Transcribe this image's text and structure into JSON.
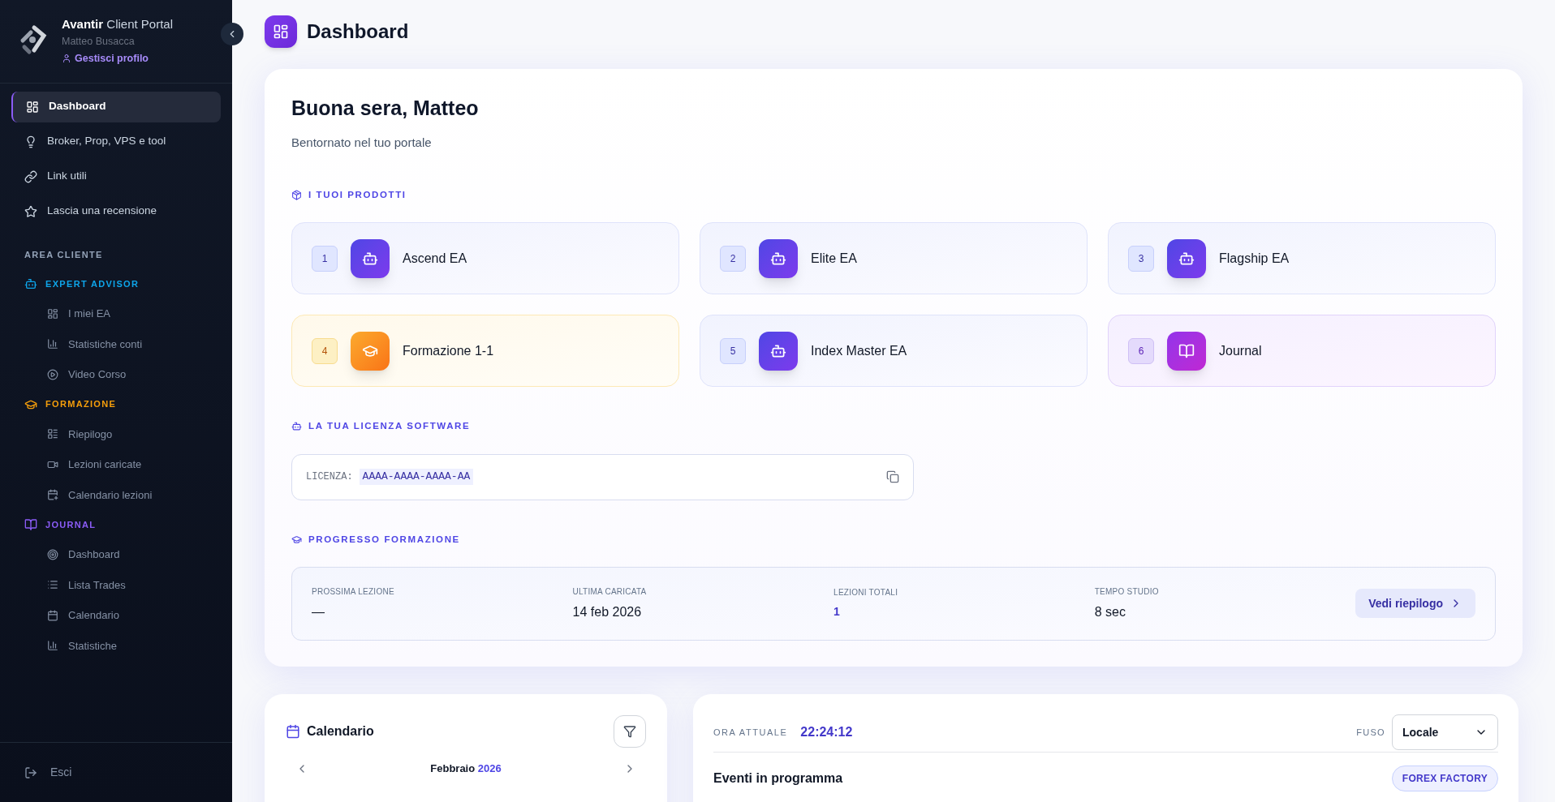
{
  "brand": {
    "name": "Avantir",
    "suffix": "Client Portal",
    "user": "Matteo Busacca",
    "profile_link": "Gestisci profilo"
  },
  "nav": [
    {
      "label": "Dashboard",
      "selected": true
    },
    {
      "label": "Broker, Prop, VPS e tool",
      "selected": false
    },
    {
      "label": "Link utili",
      "selected": false
    },
    {
      "label": "Lascia una recensione",
      "selected": false
    }
  ],
  "section_label": "AREA CLIENTE",
  "groups": [
    {
      "title": "EXPERT ADVISOR",
      "color": "#0ea5e9",
      "items": [
        {
          "label": "I miei EA"
        },
        {
          "label": "Statistiche conti"
        },
        {
          "label": "Video Corso"
        }
      ]
    },
    {
      "title": "FORMAZIONE",
      "color": "#f59e0b",
      "items": [
        {
          "label": "Riepilogo"
        },
        {
          "label": "Lezioni caricate"
        },
        {
          "label": "Calendario lezioni"
        }
      ]
    },
    {
      "title": "JOURNAL",
      "color": "#8b5cf6",
      "items": [
        {
          "label": "Dashboard"
        },
        {
          "label": "Lista Trades"
        },
        {
          "label": "Calendario"
        },
        {
          "label": "Statistiche"
        }
      ]
    }
  ],
  "logout": "Esci",
  "page": {
    "title": "Dashboard"
  },
  "welcome": {
    "greeting": "Buona sera, Matteo",
    "subtitle": "Bentornato nel tuo portale"
  },
  "products": {
    "heading": "I TUOI PRODOTTI",
    "items": [
      {
        "number": "1",
        "name": "Ascend EA",
        "kind": "ea"
      },
      {
        "number": "2",
        "name": "Elite EA",
        "kind": "ea"
      },
      {
        "number": "3",
        "name": "Flagship EA",
        "kind": "ea"
      },
      {
        "number": "4",
        "name": "Formazione 1-1",
        "kind": "training"
      },
      {
        "number": "5",
        "name": "Index Master EA",
        "kind": "ea"
      },
      {
        "number": "6",
        "name": "Journal",
        "kind": "journal"
      }
    ]
  },
  "license": {
    "heading": "LA TUA LICENZA SOFTWARE",
    "label": "LICENZA:",
    "key": "AAAA-AAAA-AAAA-AA"
  },
  "progress": {
    "heading": "PROGRESSO FORMAZIONE",
    "stats": [
      {
        "label": "PROSSIMA LEZIONE",
        "value": "—",
        "kind": "text"
      },
      {
        "label": "ULTIMA CARICATA",
        "value": "14 feb 2026",
        "kind": "text"
      },
      {
        "label": "LEZIONI TOTALI",
        "value": "1",
        "kind": "link"
      },
      {
        "label": "TEMPO STUDIO",
        "value": "8 sec",
        "kind": "text"
      }
    ],
    "button": "Vedi riepilogo"
  },
  "calendar": {
    "title": "Calendario",
    "month": "Febbraio",
    "year": "2026"
  },
  "clock": {
    "label": "ORA ATTUALE",
    "time": "22:24:12",
    "tz_label": "FUSO",
    "tz_value": "Locale",
    "events_title": "Eventi in programma",
    "source": "FOREX FACTORY"
  }
}
